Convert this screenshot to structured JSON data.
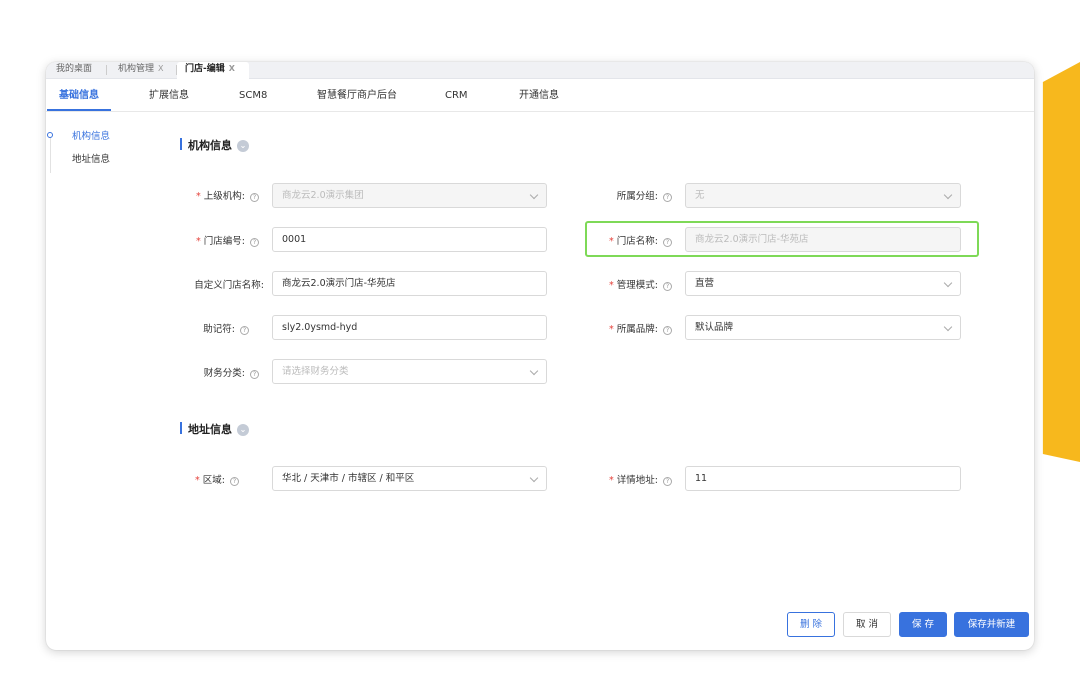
{
  "page_tabs": [
    {
      "label": "我的桌面",
      "closable": false
    },
    {
      "label": "机构管理",
      "closable": true
    },
    {
      "label": "门店-编辑",
      "closable": true,
      "active": true
    }
  ],
  "close_glyph": "X",
  "sub_tabs": [
    "基础信息",
    "扩展信息",
    "SCM8",
    "智慧餐厅商户后台",
    "CRM",
    "开通信息"
  ],
  "anchor_nav": [
    "机构信息",
    "地址信息"
  ],
  "sections": {
    "org": "机构信息",
    "address": "地址信息"
  },
  "collapse_glyph": "⌄",
  "help_glyph": "?",
  "form": {
    "parent_org": {
      "label": "上级机构:",
      "value": "商龙云2.0演示集团"
    },
    "group": {
      "label": "所属分组:",
      "value": "无"
    },
    "store_code": {
      "label": "门店编号:",
      "value": "0001"
    },
    "store_name": {
      "label": "门店名称:",
      "value": "商龙云2.0演示门店-华苑店"
    },
    "custom_name": {
      "label": "自定义门店名称:",
      "value": "商龙云2.0演示门店-华苑店"
    },
    "mgmt_mode": {
      "label": "管理模式:",
      "value": "直营"
    },
    "mnemonic": {
      "label": "助记符:",
      "value": "sly2.0ysmd-hyd"
    },
    "brand": {
      "label": "所属品牌:",
      "value": "默认品牌"
    },
    "finance": {
      "label": "财务分类:",
      "placeholder": "请选择财务分类"
    },
    "region": {
      "label": "区域:",
      "value": "华北 / 天津市 / 市辖区 / 和平区"
    },
    "address": {
      "label": "详情地址:",
      "value": "11"
    }
  },
  "buttons": {
    "delete": "删 除",
    "cancel": "取 消",
    "save": "保 存",
    "save_new": "保存并新建"
  },
  "colors": {
    "primary": "#3872de",
    "highlight": "#7ed957",
    "accent": "#f7b81d",
    "required": "#e5413a"
  }
}
